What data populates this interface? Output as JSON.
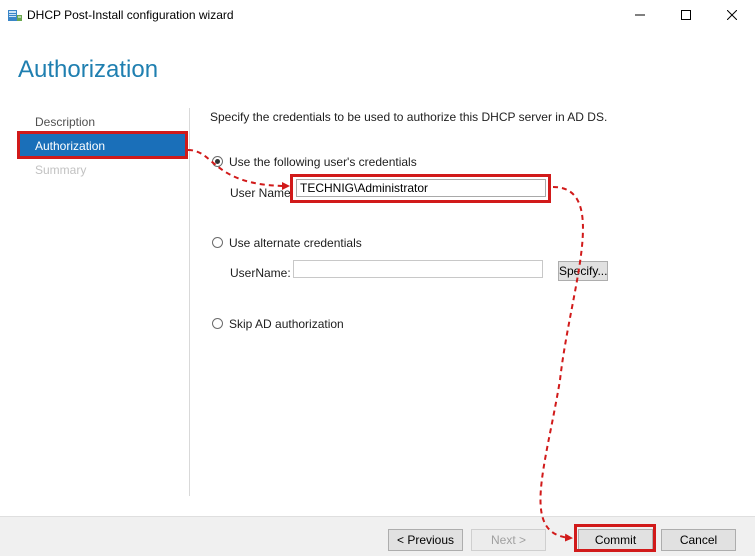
{
  "window": {
    "title": "DHCP Post-Install configuration wizard",
    "icon": "dhcp-server-icon",
    "controls": [
      "minimize-icon",
      "maximize-icon",
      "close-icon"
    ]
  },
  "page": {
    "heading": "Authorization"
  },
  "nav": {
    "items": [
      {
        "label": "Description",
        "state": "normal"
      },
      {
        "label": "Authorization",
        "state": "selected"
      },
      {
        "label": "Summary",
        "state": "disabled"
      }
    ]
  },
  "content": {
    "instruction": "Specify the credentials to be used to authorize this DHCP server in AD DS.",
    "options": [
      {
        "label": "Use the following user's credentials",
        "checked": true,
        "field_label": "User Name:",
        "value": "TECHNIG\\Administrator"
      },
      {
        "label": "Use alternate credentials",
        "checked": false,
        "field_label": "UserName:",
        "value": "",
        "button": "Specify..."
      },
      {
        "label": "Skip AD authorization",
        "checked": false
      }
    ]
  },
  "footer": {
    "previous": "< Previous",
    "next": "Next >",
    "commit": "Commit",
    "cancel": "Cancel"
  },
  "annotation": {
    "color": "#d11a1a",
    "highlighted": [
      "Authorization",
      "TECHNIG\\Administrator",
      "Commit"
    ]
  }
}
